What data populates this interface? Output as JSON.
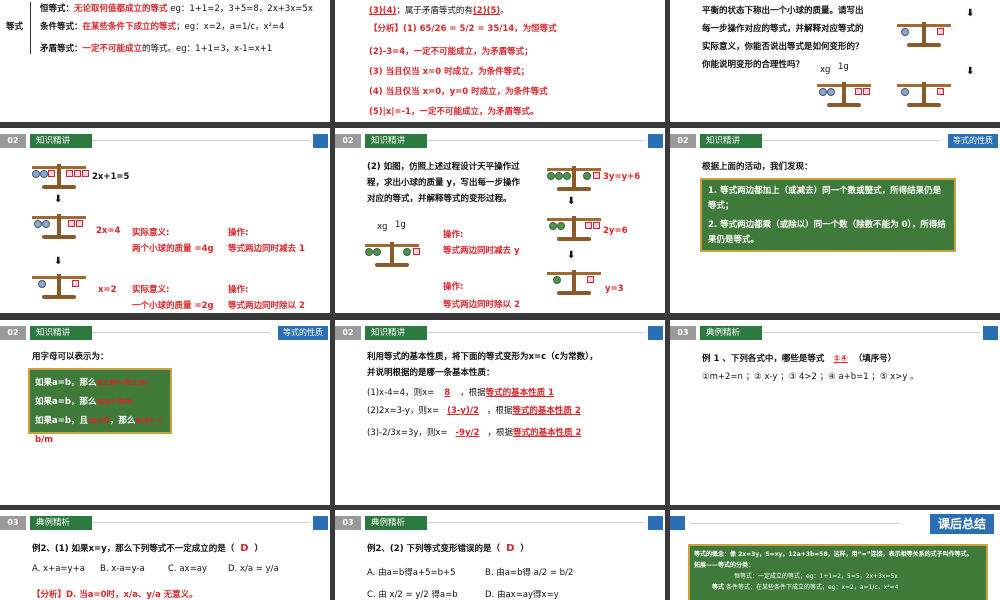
{
  "s1": {
    "l1a": "恒等式：",
    "l1b": "无论取何值都成立的等式",
    "l1c": "eg：1+1=2，3+5=8，2x+3x=5x",
    "label": "等式",
    "l2a": "条件等式：",
    "l2b": "在某些条件下成立的等式",
    "l2c": "；eg：x=2，a=1/c，x²=4",
    "l3a": "矛盾等式：",
    "l3b": "一定不可能成立",
    "l3c": "的等式。eg：1+1=3，x-1=x+1"
  },
  "s2": {
    "t1": "(3)(4)",
    "t2": "；属于矛盾等式的有",
    "t3": "(2)(5)",
    "t4": "。",
    "a1": "【分析】(1) 65/26 = 5/2 = 35/14，为恒等式",
    "a2": "(2)-3=4，一定不可能成立，为矛盾等式；",
    "a3": "(3) 当且仅当 x=0 时成立，为条件等式；",
    "a4": "(4) 当且仅当 x=0，y=0 时成立，为条件等式",
    "a5": "(5)|x|=-1，一定不可能成立，为矛盾等式。"
  },
  "s3": {
    "p1": "平衡的状态下称出一个小球的质量。请写出",
    "p2": "每一步操作对应的等式，并解释对应等式的",
    "p3": "实际意义，你能否说出等式是如何变形的？",
    "p4": "你能说明变形的合理性吗？",
    "xg": "xg",
    "g1": "1g"
  },
  "s4": {
    "num": "02",
    "title": "知识精讲",
    "e1": "2x+1=5",
    "e2": "2x=4",
    "e3": "x=2",
    "m1": "实际意义:",
    "m1b": "两个小球的质量 =4g",
    "o1": "操作:",
    "o1b": "等式两边同时减去 1",
    "m2": "实际意义:",
    "m2b": "一个小球的质量 =2g",
    "o2": "操作:",
    "o2b": "等式两边同时除以 2"
  },
  "s5": {
    "num": "02",
    "title": "知识精讲",
    "p1": "(2) 如图，仿照上述过程设计天平操作过",
    "p2": "程，求出小球的质量 y，写出每一步操作",
    "p3": "对应的等式，并解释等式的变形过程。",
    "e1": "3y=y+6",
    "e2": "2y=6",
    "e3": "y=3",
    "xg": "xg",
    "g1": "1g",
    "o1": "操作:",
    "o1b": "等式两边同时减去 y",
    "o2": "操作:",
    "o2b": "等式两边同时除以 2"
  },
  "s6": {
    "num": "02",
    "title": "知识精讲",
    "tag": "等式的性质",
    "intro": "根据上面的活动，我们发现：",
    "r1": "1. 等式两边都加上（或减去）同一个数或整式，所得结果仍是等式；",
    "r2": "2. 等式两边都乘（或除以）同一个数（除数不能为 0），所得结果仍是等式。"
  },
  "s7": {
    "num": "02",
    "title": "知识精讲",
    "tag": "等式的性质",
    "intro": "用字母可以表示为：",
    "f1a": "如果a=b，那么",
    "f1b": "a±m=b±m",
    "f2a": "如果a=b，那么",
    "f2b": "am=bm",
    "f3a": "如果a=b，且",
    "f3b": "m≠0",
    "f3c": "，那么",
    "f3d": "a/m = b/m"
  },
  "s8": {
    "num": "02",
    "title": "知识精讲",
    "p1": "利用等式的基本性质，将下面的等式变形为x=c（c为常数），",
    "p2": "并说明根据的是哪一条基本性质：",
    "q1a": "(1)x-4=4，则x=",
    "q1b": "8",
    "q1c": "，根据",
    "q1d": "等式的基本性质 1",
    "q2a": "(2)2x=3-y，则x=",
    "q2b": "(3-y)/2",
    "q2c": "，根据",
    "q2d": "等式的基本性质 2",
    "q3a": "(3)-2/3x=3y，则x=",
    "q3b": "-9y/2",
    "q3c": "，根据",
    "q3d": "等式的基本性质 2"
  },
  "s9": {
    "num": "03",
    "title": "典例精析",
    "q": "例 1 、下列各式中，哪些是等式",
    "ans": "①④",
    "q2": "（填序号）",
    "opts": "①m+2=n ；② x-y ；③ 4>2 ；④ a+b=1 ；⑤ x>y 。"
  },
  "s10": {
    "num": "03",
    "title": "典例精析",
    "q": "例2、(1) 如果x=y，那么下列等式不一定成立的是（",
    "ans": "D",
    "q2": "）",
    "oa": "A. x+a=y+a",
    "ob": "B. x-a=y-a",
    "oc": "C. ax=ay",
    "od": "D. x/a = y/a",
    "an": "【分析】D. 当a=0时，x/a、y/a 无意义。"
  },
  "s11": {
    "num": "03",
    "title": "典例精析",
    "q": "例2、(2) 下列等式变形错误的是（",
    "ans": "D",
    "q2": "）",
    "oa": "A. 由a=b得a+5=b+5",
    "ob": "B. 由a=b得 a/2 = b/2",
    "oc": "C. 由 x/2 = y/2 得a=b",
    "od": "D. 由ax=ay得x=y"
  },
  "s12": {
    "tag": "课后总结",
    "l1": "等式的概念：像 2x=3y，S=xy，12a+3b=58，这样，用“=”连接，表示相等关系的式子叫作等式。",
    "l2": "拓展——等式的分类：",
    "c1": "恒等式：一定成立的等式；eg：1+1=2，5=5，2x+3x=5x",
    "c2": "条件等式：在某些条件下成立的等式；eg：x=2，a=1/c，x²=4",
    "lbl": "等式"
  }
}
